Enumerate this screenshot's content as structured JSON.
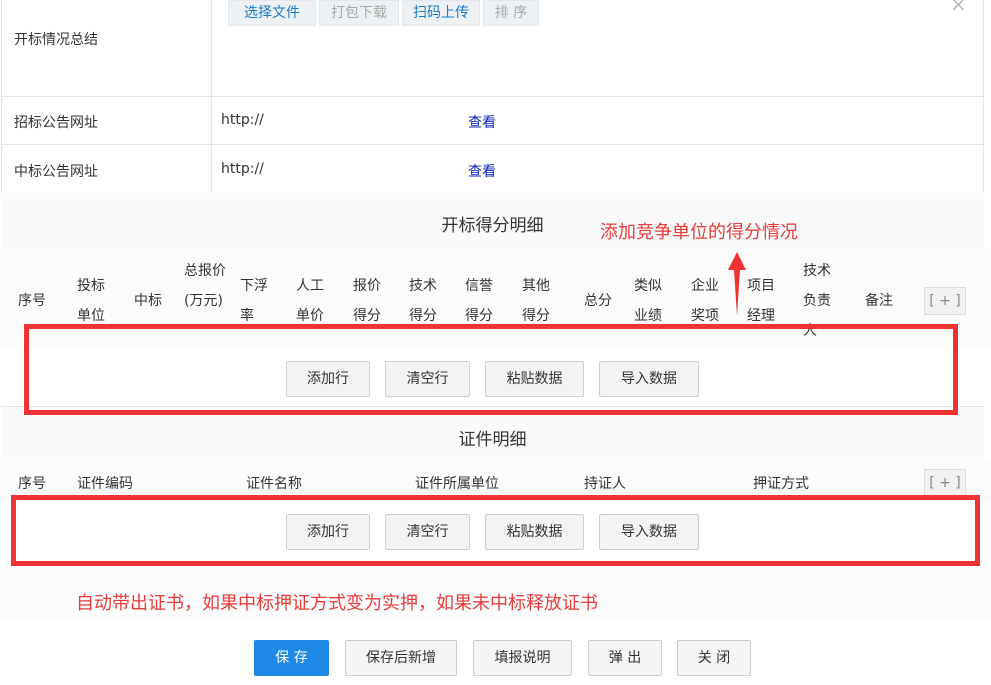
{
  "form": {
    "summary_label": "开标情况总结",
    "file_buttons": [
      "选择文件",
      "打包下载",
      "扫码上传",
      "排 序"
    ],
    "close_glyph": "×",
    "tender_notice_label": "招标公告网址",
    "tender_notice_value": "http://",
    "win_notice_label": "中标公告网址",
    "win_notice_value": "http://",
    "view_link": "查看"
  },
  "score_section": {
    "title": "开标得分明细",
    "headers": [
      "序号",
      "投标单位",
      "中标",
      "总报价(万元)",
      "下浮率",
      "人工单价",
      "报价得分",
      "技术得分",
      "信誉得分",
      "其他得分",
      "总分",
      "类似业绩",
      "企业奖项",
      "项目经理",
      "技术负责人",
      "备注"
    ],
    "plus": "[ + ]",
    "buttons": [
      "添加行",
      "清空行",
      "粘贴数据",
      "导入数据"
    ]
  },
  "cert_section": {
    "title": "证件明细",
    "headers": [
      "序号",
      "证件编码",
      "证件名称",
      "证件所属单位",
      "持证人",
      "押证方式"
    ],
    "plus": "[ + ]",
    "buttons": [
      "添加行",
      "清空行",
      "粘贴数据",
      "导入数据"
    ]
  },
  "annotations": {
    "score_note": "添加竞争单位的得分情况",
    "cert_note": "自动带出证书，如果中标押证方式变为实押，如果未中标释放证书",
    "color": "#e83b3b"
  },
  "footer": {
    "buttons": [
      "保 存",
      "保存后新增",
      "填报说明",
      "弹 出",
      "关 闭"
    ],
    "primary_color": "#1e88e5"
  }
}
